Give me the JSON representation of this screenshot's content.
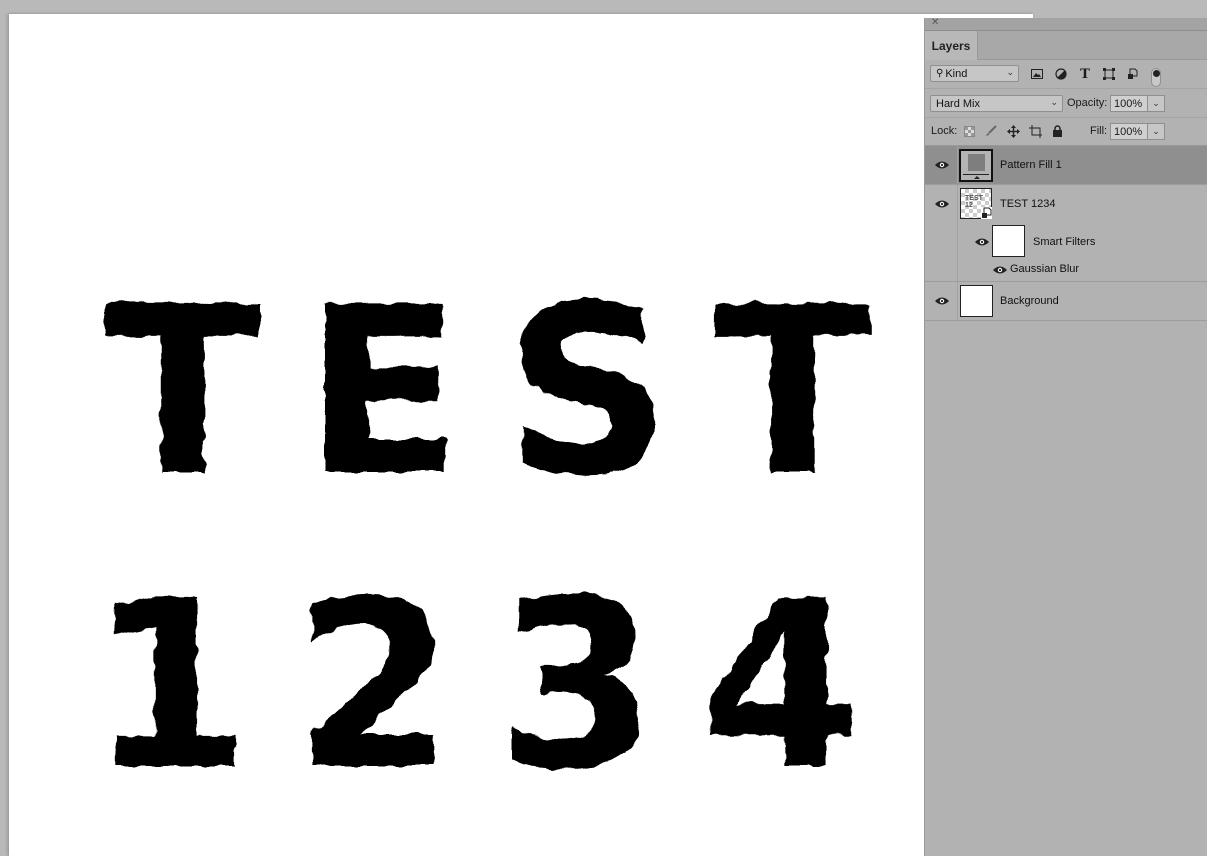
{
  "canvas": {
    "text_line_1": "TEST",
    "text_line_2": "1234"
  },
  "panel": {
    "close_icon": "close-icon",
    "tab_label": "Layers",
    "filter": {
      "kind_label": "Kind",
      "icons": [
        "image-filter-icon",
        "adjustment-filter-icon",
        "type-filter-icon",
        "shape-filter-icon",
        "smart-object-filter-icon"
      ]
    },
    "blend_mode": "Hard Mix",
    "opacity_label": "Opacity:",
    "opacity_value": "100%",
    "lock_label": "Lock:",
    "fill_label": "Fill:",
    "fill_value": "100%",
    "layers": [
      {
        "name": "Pattern Fill 1",
        "visible": true,
        "selected": true,
        "type": "pattern-fill"
      },
      {
        "name": "TEST 1234",
        "visible": true,
        "selected": false,
        "type": "smart-object",
        "thumb_text": "TEST 12"
      },
      {
        "name": "Smart Filters",
        "visible": true,
        "type": "smart-filters"
      },
      {
        "name": "Gaussian Blur",
        "visible": true,
        "type": "filter"
      },
      {
        "name": "Background",
        "visible": true,
        "selected": false,
        "type": "background"
      }
    ]
  }
}
